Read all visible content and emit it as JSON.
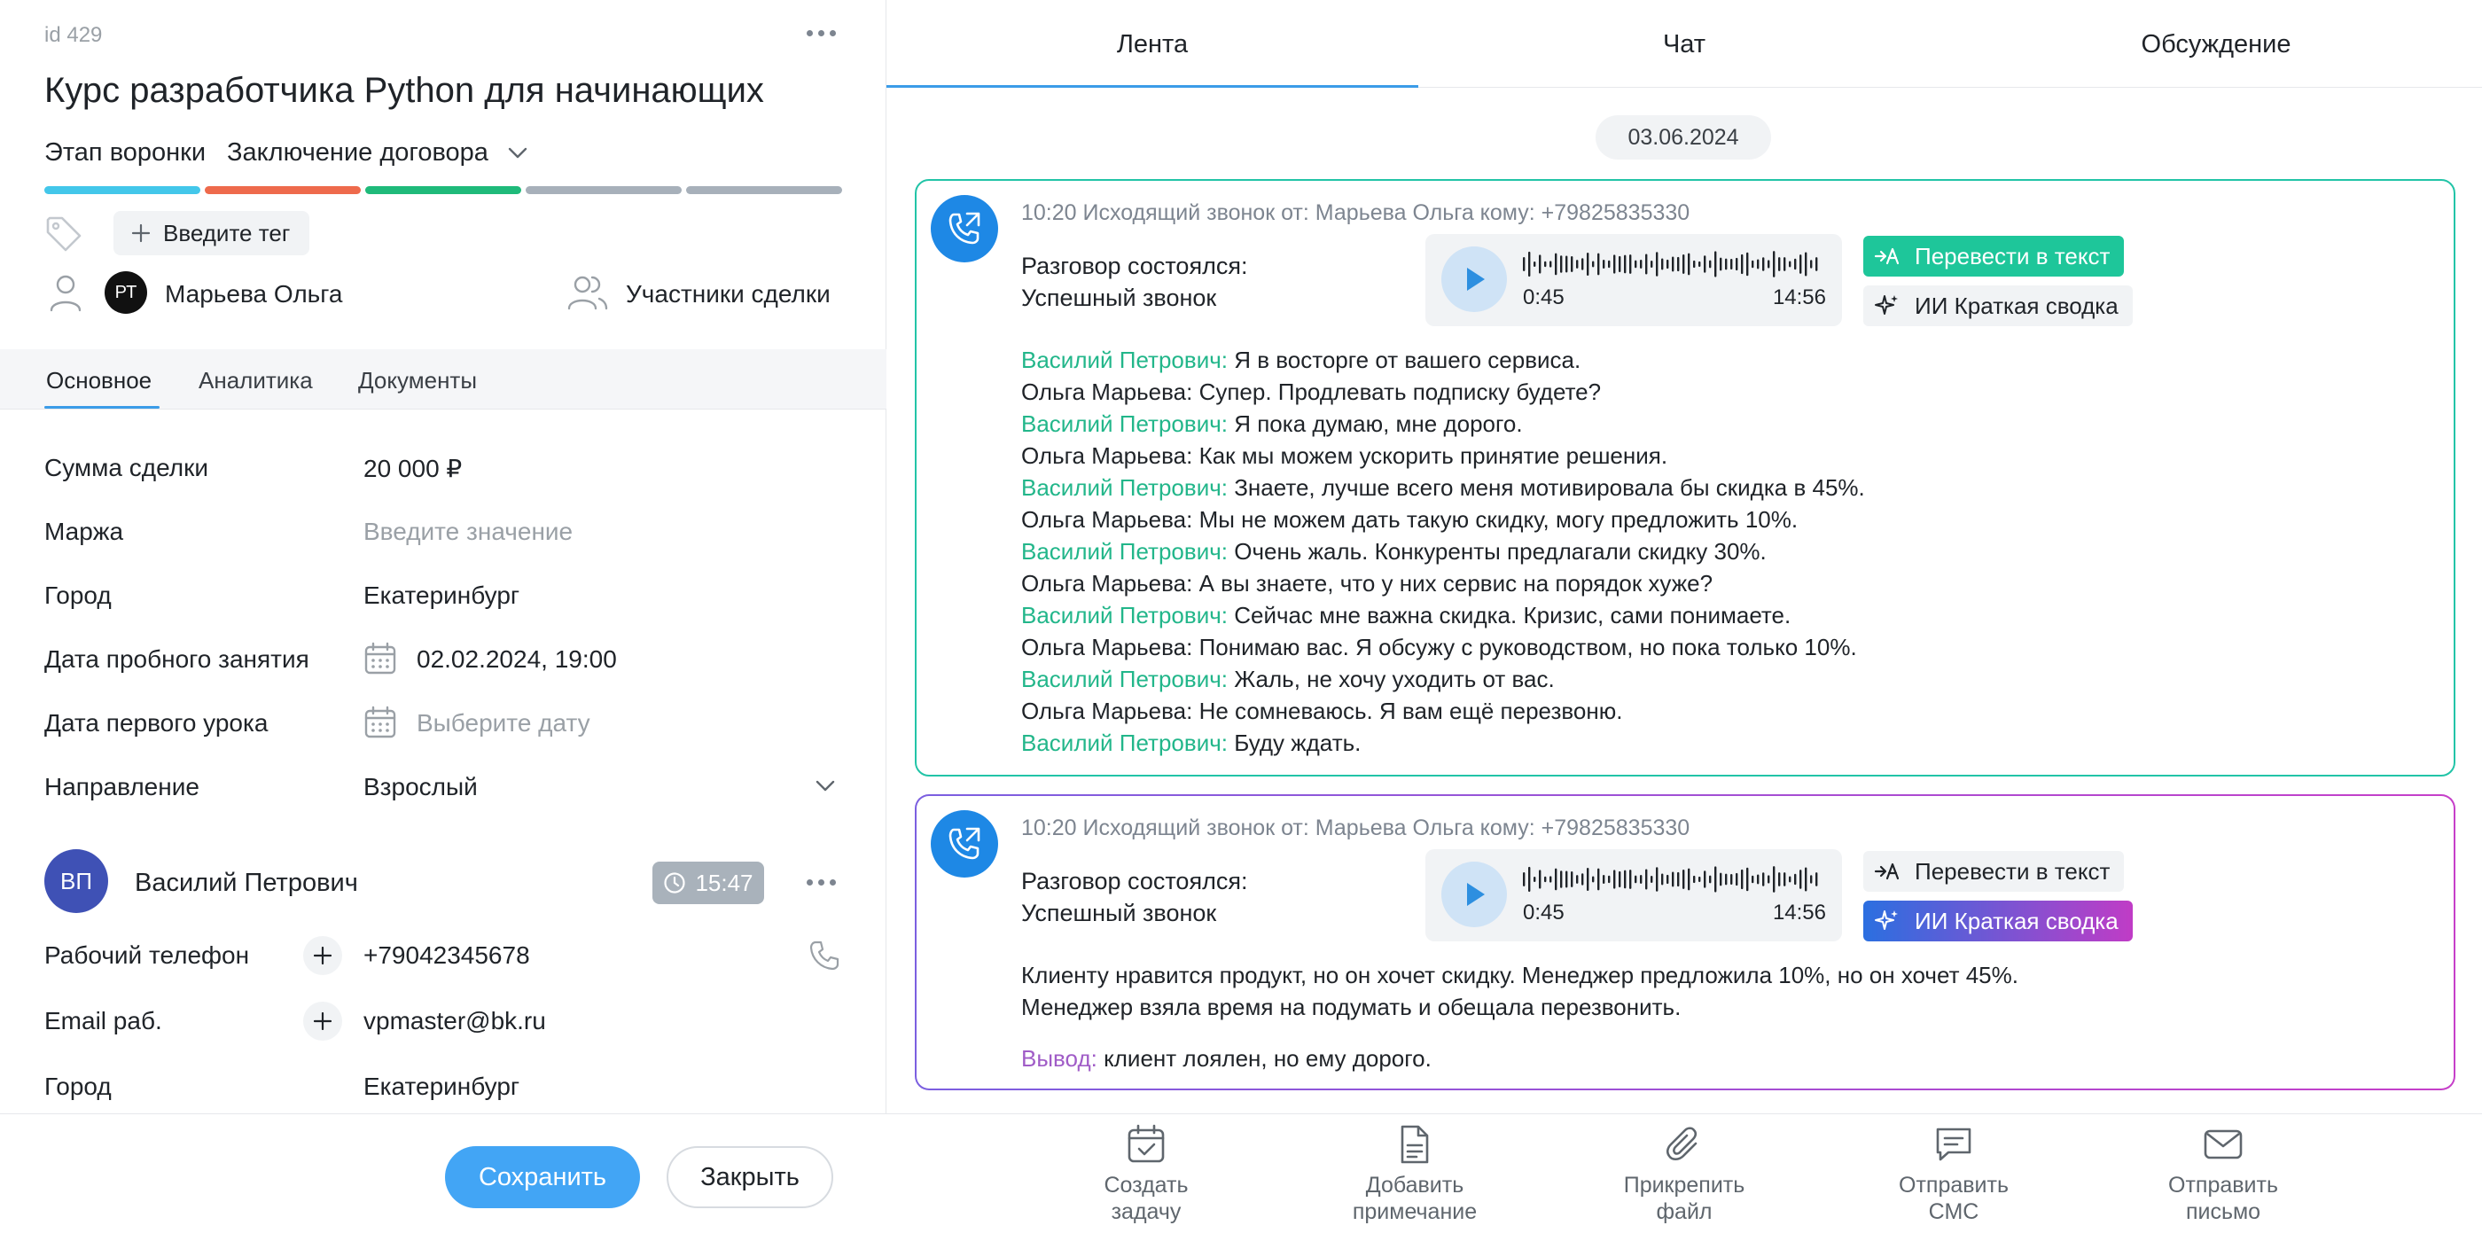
{
  "deal": {
    "id_label": "id 429",
    "title": "Курс разработчика Python для начинающих",
    "funnel_label": "Этап воронки",
    "funnel_value": "Заключение договора",
    "stages": [
      {
        "color": "#43c7ea"
      },
      {
        "color": "#ee6a4c"
      },
      {
        "color": "#1fba7a"
      },
      {
        "color": "#a7b0ba"
      },
      {
        "color": "#a7b0ba"
      }
    ],
    "tag_button": "Введите тег",
    "responsible": {
      "initials": "РТ",
      "name": "Марьева Ольга"
    },
    "participants_label": "Участники сделки"
  },
  "left_tabs": [
    "Основное",
    "Аналитика",
    "Документы"
  ],
  "fields": [
    {
      "label": "Сумма сделки",
      "value": "20 000 ₽"
    },
    {
      "label": "Маржа",
      "placeholder": "Введите значение"
    },
    {
      "label": "Город",
      "value": "Екатеринбург"
    },
    {
      "label": "Дата пробного занятия",
      "value": "02.02.2024, 19:00"
    },
    {
      "label": "Дата первого урока",
      "placeholder": "Выберите дату"
    },
    {
      "label": "Направление",
      "value": "Взрослый"
    }
  ],
  "contact": {
    "initials": "ВП",
    "name": "Василий Петрович",
    "time": "15:47",
    "work_phone_label": "Рабочий телефон",
    "work_phone": "+79042345678",
    "email_label": "Email раб.",
    "email": "vpmaster@bk.ru",
    "city_label": "Город",
    "city": "Екатеринбург"
  },
  "buttons": {
    "save": "Сохранить",
    "close": "Закрыть"
  },
  "right_tabs": [
    "Лента",
    "Чат",
    "Обсуждение"
  ],
  "feed_date": "03.06.2024",
  "calls": [
    {
      "meta": "10:20 Исходящий звонок от: Марьева Ольга кому: +79825835330",
      "status1": "Разговор состоялся:",
      "status2": "Успешный звонок",
      "time_start": "0:45",
      "time_end": "14:56",
      "action_transcribe": "Перевести в текст",
      "action_summary": "ИИ Краткая сводка",
      "transcript": [
        {
          "speaker": "Василий Петрович:",
          "text": "Я в восторге от вашего сервиса.",
          "client": true
        },
        {
          "speaker": "Ольга Марьева:",
          "text": "Супер. Продлевать подписку будете?",
          "client": false
        },
        {
          "speaker": "Василий Петрович:",
          "text": "Я пока думаю, мне дорого.",
          "client": true
        },
        {
          "speaker": "Ольга Марьева:",
          "text": "Как мы можем ускорить принятие решения.",
          "client": false
        },
        {
          "speaker": "Василий Петрович:",
          "text": "Знаете, лучше всего меня мотивировала бы скидка в 45%.",
          "client": true
        },
        {
          "speaker": "Ольга Марьева:",
          "text": "Мы не можем дать такую скидку, могу предложить 10%.",
          "client": false
        },
        {
          "speaker": "Василий Петрович:",
          "text": "Очень жаль. Конкуренты предлагали скидку 30%.",
          "client": true
        },
        {
          "speaker": "Ольга Марьева:",
          "text": "А вы знаете, что у них сервис на порядок хуже?",
          "client": false
        },
        {
          "speaker": "Василий Петрович:",
          "text": "Сейчас мне важна скидка. Кризис, сами понимаете.",
          "client": true
        },
        {
          "speaker": "Ольга Марьева:",
          "text": "Понимаю вас. Я обсужу с руководством, но пока только 10%.",
          "client": false
        },
        {
          "speaker": "Василий Петрович:",
          "text": "Жаль, не хочу уходить от вас.",
          "client": true
        },
        {
          "speaker": "Ольга Марьева:",
          "text": "Не сомневаюсь. Я вам ещё перезвоню.",
          "client": false
        },
        {
          "speaker": "Василий Петрович:",
          "text": "Буду ждать.",
          "client": true
        }
      ]
    },
    {
      "meta": "10:20 Исходящий звонок от: Марьева Ольга кому: +79825835330",
      "status1": "Разговор состоялся:",
      "status2": "Успешный звонок",
      "time_start": "0:45",
      "time_end": "14:56",
      "action_transcribe": "Перевести в текст",
      "action_summary": "ИИ Краткая сводка",
      "summary1": "Клиенту нравится продукт, но он хочет скидку. Менеджер предложила 10%, но он хочет 45%.",
      "summary2": "Менеджер взяла время на подумать и обещала перезвонить.",
      "conclusion_label": "Вывод:",
      "conclusion": "клиент лоялен, но ему дорого."
    }
  ],
  "footer_actions": [
    {
      "line1": "Создать",
      "line2": "задачу",
      "icon": "calendar-check-icon"
    },
    {
      "line1": "Добавить",
      "line2": "примечание",
      "icon": "document-icon"
    },
    {
      "line1": "Прикрепить",
      "line2": "файл",
      "icon": "paperclip-icon"
    },
    {
      "line1": "Отправить",
      "line2": "СМС",
      "icon": "chat-bubble-icon"
    },
    {
      "line1": "Отправить",
      "line2": "письмо",
      "icon": "envelope-icon"
    }
  ],
  "colors": {
    "accent": "#42a5f5",
    "client_speaker": "#22b68a",
    "conclusion": "#a05cc7",
    "call_icon": "#1e88e5"
  }
}
